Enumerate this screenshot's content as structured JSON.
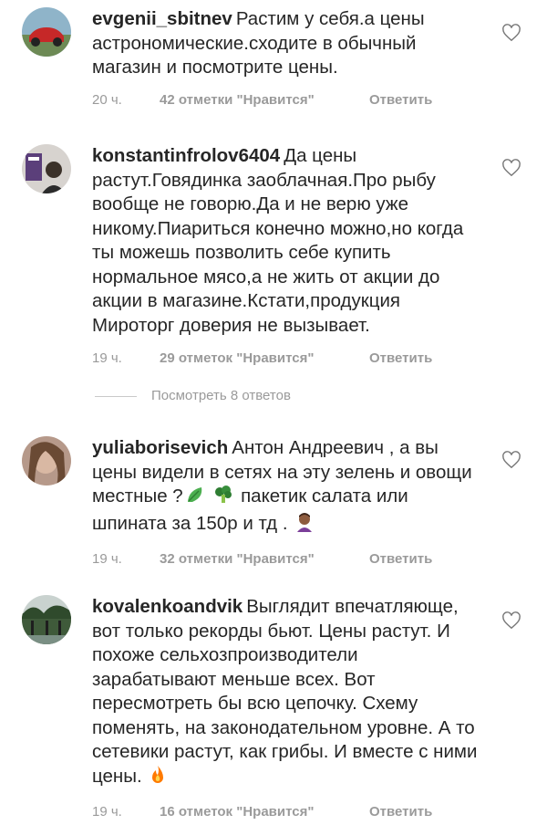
{
  "comments": [
    {
      "username": "evgenii_sbitnev",
      "text": "Растим у себя.а цены астрономические.сходите в обычный магазин и посмотрите цены.",
      "time": "20 ч.",
      "likes": "42 отметки \"Нравится\"",
      "reply": "Ответить"
    },
    {
      "username": "konstantinfrolov6404",
      "text": "Да цены растут.Говядинка заоблачная.Про рыбу вообще не говорю.Да и не верю уже никому.Пиариться конечно можно,но когда ты можешь позволить себе купить нормальное мясо,а не жить от акции до акции в магазине.Кстати,продукция Мироторг доверия не вызывает.",
      "time": "19 ч.",
      "likes": "29 отметок \"Нравится\"",
      "reply": "Ответить"
    },
    {
      "username": "yuliaborisevich",
      "text_part1": "Антон Андреевич , а вы цены видели в сетях на эту зелень и овощи  местные ?",
      "text_part2": " пакетик салата или шпината за 150р и тд .",
      "time": "19 ч.",
      "likes": "32 отметки \"Нравится\"",
      "reply": "Ответить"
    },
    {
      "username": "kovalenkoandvik",
      "text": "Выглядит впечатляюще, вот только рекорды бьют. Цены растут. И похоже сельхозпроизводители зарабатывают меньше всех. Вот пересмотреть бы всю цепочку. Схему поменять, на законодательном уровне. А то сетевики растут, как грибы. И вместе с ними цены.",
      "time": "19 ч.",
      "likes": "16 отметок \"Нравится\"",
      "reply": "Ответить"
    }
  ],
  "view_replies": "Посмотреть 8 ответов",
  "icons": {
    "like": "heart-outline-icon",
    "emoji_leaf": "leafy-green-emoji",
    "emoji_broccoli": "broccoli-emoji",
    "emoji_facepalm": "woman-facepalming-emoji",
    "emoji_fire": "fire-emoji"
  },
  "colors": {
    "text": "#262626",
    "meta": "#9a9a9a",
    "divider": "#c9c9c9",
    "background": "#ffffff"
  }
}
